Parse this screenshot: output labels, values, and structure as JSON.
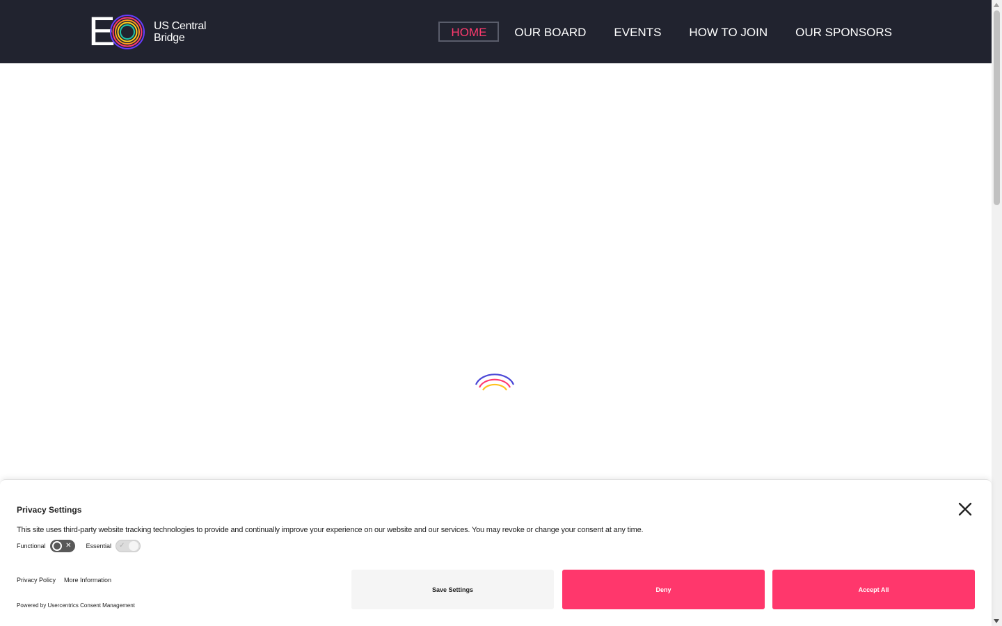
{
  "header": {
    "logo_letter": "E",
    "logo_line1": "US Central",
    "logo_line2": "Bridge",
    "nav": [
      {
        "label": "HOME",
        "active": true
      },
      {
        "label": "OUR BOARD",
        "active": false
      },
      {
        "label": "EVENTS",
        "active": false
      },
      {
        "label": "HOW TO JOIN",
        "active": false
      },
      {
        "label": "OUR SPONSORS",
        "active": false
      }
    ]
  },
  "loader": {
    "icon": "rainbow-arcs-loader-icon"
  },
  "consent": {
    "title": "Privacy Settings",
    "description": "This site uses third-party website tracking technologies to provide and continually improve your experience on our website and our services. You may revoke or change your consent at any time.",
    "toggles": [
      {
        "label": "Functional",
        "state": "off"
      },
      {
        "label": "Essential",
        "state": "on"
      }
    ],
    "links": {
      "privacy": "Privacy Policy",
      "more": "More Information"
    },
    "powered_by": "Powered by Usercentrics Consent Management",
    "buttons": {
      "save": "Save Settings",
      "deny": "Deny",
      "accept": "Accept All"
    }
  },
  "colors": {
    "header_bg": "#21232f",
    "accent": "#ff376c",
    "nav_active": "#ff3a6e"
  }
}
